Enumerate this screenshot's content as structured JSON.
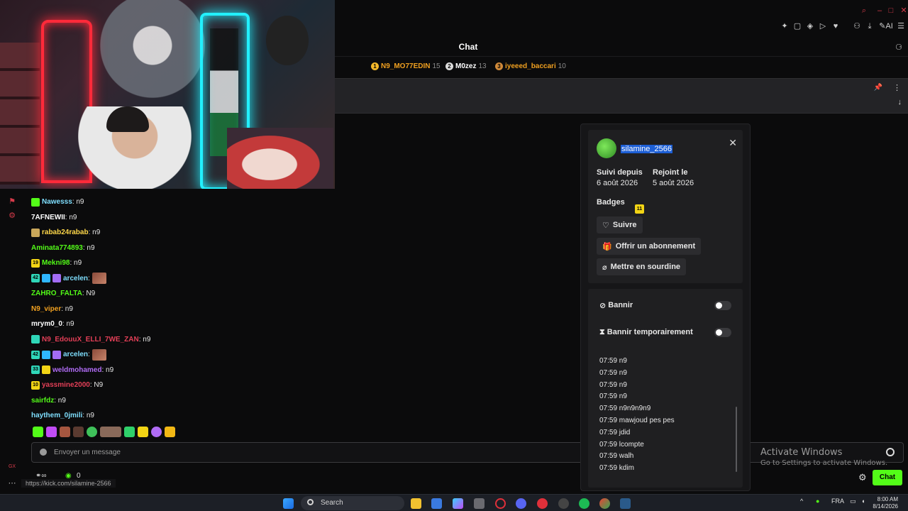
{
  "chat": {
    "title": "Chat",
    "leaderboard": [
      {
        "rank": "1",
        "name": "N9_MO77EDIN",
        "count": "15",
        "color": "#f0a020",
        "rank_color": "#f5b82a"
      },
      {
        "rank": "2",
        "name": "M0zez",
        "count": "13",
        "color": "#ffffff",
        "rank_color": "#dcdcdc"
      },
      {
        "rank": "3",
        "name": "iyeeed_baccari",
        "count": "10",
        "color": "#f0a020",
        "rank_color": "#d08a3a"
      }
    ],
    "messages": [
      {
        "user": "Nawesss",
        "text": ": n9",
        "color": "#7fdfff",
        "badges": [
          {
            "t": "",
            "c": "#53fc18"
          }
        ]
      },
      {
        "user": "7AFNEWII",
        "text": ": n9",
        "color": "#ffffff",
        "badges": []
      },
      {
        "user": "rabab24rabab",
        "text": ": n9",
        "color": "#ffd84a",
        "badges": [
          {
            "t": "",
            "c": "#c9a75a"
          }
        ]
      },
      {
        "user": "Aminata774893",
        "text": ": n9",
        "color": "#53fc18",
        "badges": []
      },
      {
        "user": "Mekni98",
        "text": ": n9",
        "color": "#53fc18",
        "badges": [
          {
            "t": "19",
            "c": "#f2d415"
          }
        ]
      },
      {
        "user": "arcelen",
        "text": ":",
        "color": "#7fdfff",
        "badges": [
          {
            "t": "42",
            "c": "#2fd6b8"
          },
          {
            "t": "",
            "c": "#2fb6ff"
          },
          {
            "t": "",
            "c": "#a36cf5"
          }
        ],
        "emote": true
      },
      {
        "user": "ZAHRO_FALTA",
        "text": ": N9",
        "color": "#53fc18",
        "badges": []
      },
      {
        "user": "N9_viper",
        "text": ": n9",
        "color": "#f0a020",
        "badges": []
      },
      {
        "user": "mrym0_0",
        "text": ": n9",
        "color": "#ffffff",
        "badges": []
      },
      {
        "user": "N9_EdouuX_ELLI_7WE_ZAN",
        "text": ": n9",
        "color": "#e33f57",
        "badges": [
          {
            "t": "",
            "c": "#2fd6b8"
          }
        ]
      },
      {
        "user": "arcelen",
        "text": ":",
        "color": "#7fdfff",
        "badges": [
          {
            "t": "42",
            "c": "#2fd6b8"
          },
          {
            "t": "",
            "c": "#2fb6ff"
          },
          {
            "t": "",
            "c": "#a36cf5"
          }
        ],
        "emote": true
      },
      {
        "user": "weldmohamed",
        "text": ": n9",
        "color": "#b06cf5",
        "badges": [
          {
            "t": "33",
            "c": "#2fd6b8"
          },
          {
            "t": "",
            "c": "#f2d415"
          }
        ]
      },
      {
        "user": "yassmine2000",
        "text": ": N9",
        "color": "#e33f57",
        "badges": [
          {
            "t": "10",
            "c": "#f2d415"
          }
        ]
      },
      {
        "user": "sairfdz",
        "text": ": n9",
        "color": "#53fc18",
        "badges": []
      },
      {
        "user": "haythem_0jmili",
        "text": ": n9",
        "color": "#7fdfff",
        "badges": []
      }
    ],
    "input_placeholder": "Envoyer un message",
    "footer_count": "0",
    "chat_button": "Chat",
    "status_url": "https://kick.com/silamine-2566"
  },
  "popup": {
    "username": "silamine_2566",
    "followed_label": "Suivi depuis",
    "followed_value": "6 août 2026",
    "joined_label": "Rejoint le",
    "joined_value": "5 août 2026",
    "badges_label": "Badges",
    "badge_value": "11",
    "follow_button": "Suivre",
    "gift_button": "Offrir un abonnement",
    "mute_button": "Mettre en sourdine",
    "ban_label": "Bannir",
    "temp_ban_label": "Bannir temporairement",
    "history": [
      "07:59 n9",
      "07:59 n9",
      "07:59 n9",
      "07:59 n9",
      "07:59 n9n9n9n9",
      "07:59 mawjoud pes pes",
      "07:59 jdid",
      "07:59 lcompte",
      "07:59 walh",
      "07:59 kdim"
    ]
  },
  "watermark": {
    "line1": "Activate Windows",
    "line2": "Go to Settings to activate Windows."
  },
  "taskbar": {
    "search": "Search",
    "lang": "FRA",
    "time": "8:00 AM",
    "date": "8/14/2026"
  }
}
